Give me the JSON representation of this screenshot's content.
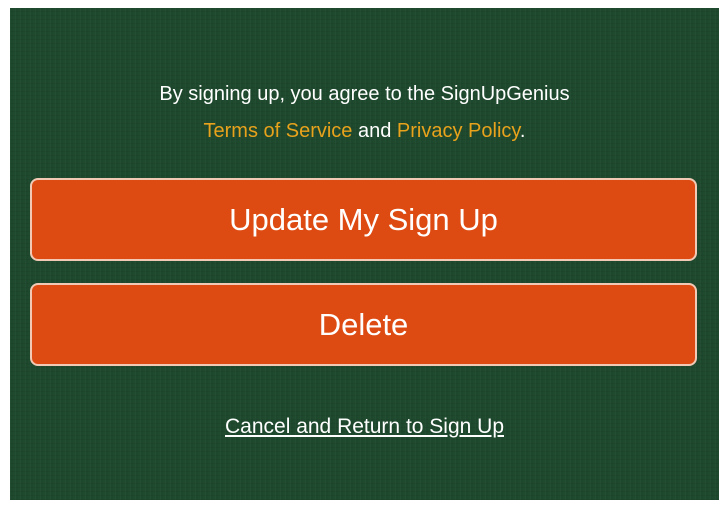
{
  "agreement": {
    "line1": "By signing up, you agree to the SignUpGenius",
    "terms_link": "Terms of Service",
    "and_text": " and ",
    "privacy_link": "Privacy Policy",
    "period": "."
  },
  "buttons": {
    "update_label": "Update My Sign Up",
    "delete_label": "Delete"
  },
  "cancel_link": "Cancel and Return to Sign Up",
  "colors": {
    "background": "#1f4a2e",
    "button": "#de4b12",
    "link_accent": "#e8a21c",
    "text": "#ffffff"
  }
}
